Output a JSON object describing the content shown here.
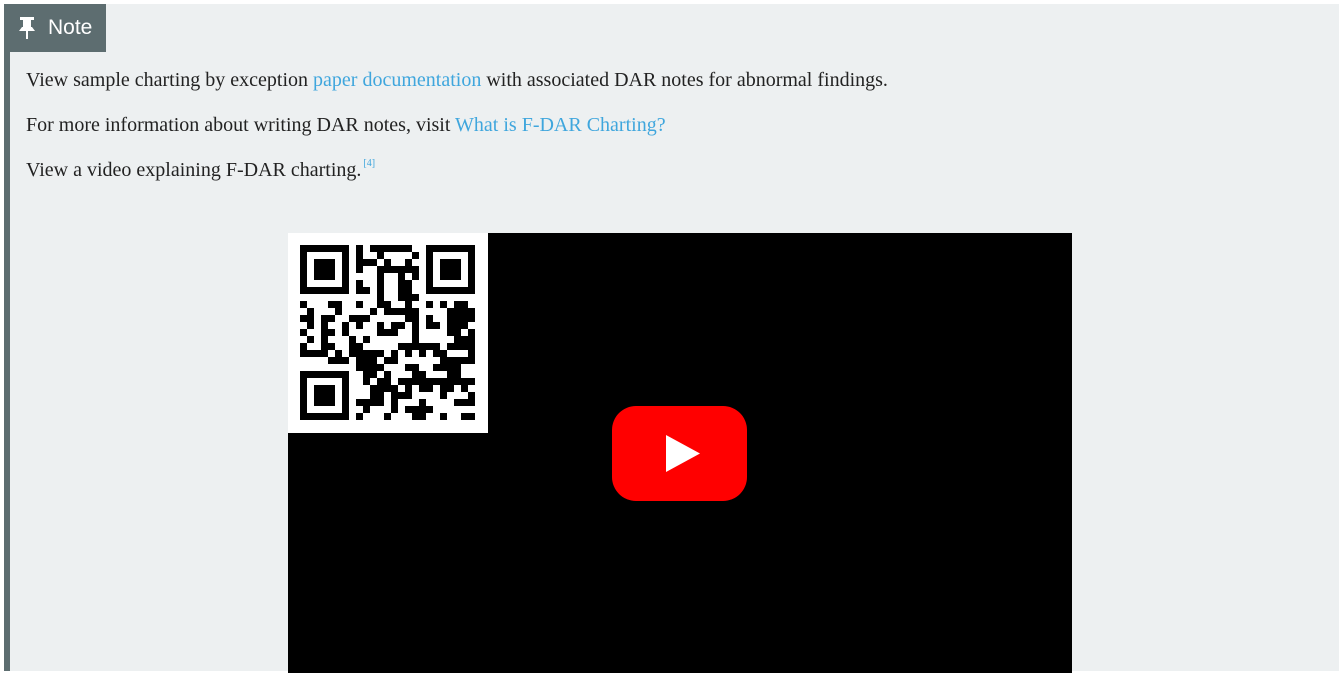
{
  "note": {
    "title": "Note",
    "pin_icon": "thumbtack-icon"
  },
  "content": {
    "line1": {
      "before": "View sample charting by exception ",
      "link": "paper documentation",
      "after": " with associated DAR notes for abnormal findings."
    },
    "line2": {
      "before": "For more information about writing DAR notes, visit ",
      "link": "What is F-DAR Charting?"
    },
    "line3": {
      "text": "View a video explaining F-DAR charting.",
      "footnote": "[4]"
    }
  },
  "video": {
    "qr_icon": "qr-code-icon",
    "play_icon": "youtube-play-icon"
  },
  "colors": {
    "note_bg": "#edf0f1",
    "note_accent": "#5d6d70",
    "link": "#3fa6dd",
    "youtube_red": "#ff0000"
  }
}
